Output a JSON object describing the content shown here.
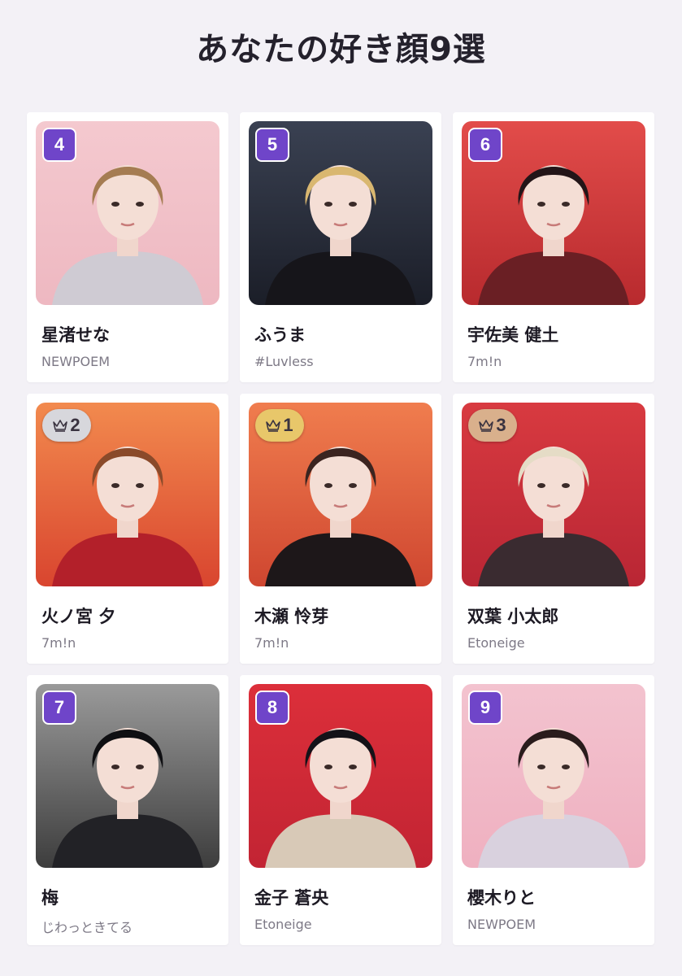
{
  "page": {
    "title": "あなたの好き顔9選"
  },
  "colors": {
    "badge_purple": "#6f45c9",
    "gold": "#e8c76a",
    "silver": "#d7d7dc",
    "bronze": "#d9b08c"
  },
  "cards": [
    {
      "rank": "4",
      "rank_style": "square",
      "name": "星渚せな",
      "group": "NEWPOEM",
      "bg_top": "#f4c9cf",
      "bg_bottom": "#eeb8c1",
      "hair": "#a57c52",
      "outfit": "#cfcbd3"
    },
    {
      "rank": "5",
      "rank_style": "square",
      "name": "ふうま",
      "group": "#Luvless",
      "bg_top": "#3a4152",
      "bg_bottom": "#1b1e28",
      "hair": "#d9b770",
      "outfit": "#16151a"
    },
    {
      "rank": "6",
      "rank_style": "square",
      "name": "宇佐美 健土",
      "group": "7m!n",
      "bg_top": "#e24c4a",
      "bg_bottom": "#b82a2e",
      "hair": "#231518",
      "outfit": "#6a1f24"
    },
    {
      "rank": "2",
      "rank_style": "silver",
      "name": "火ノ宮 夕",
      "group": "7m!n",
      "bg_top": "#f28a4e",
      "bg_bottom": "#d9452f",
      "hair": "#8a4a2a",
      "outfit": "#b3202a"
    },
    {
      "rank": "1",
      "rank_style": "gold",
      "name": "木瀬 怜芽",
      "group": "7m!n",
      "bg_top": "#f07d4e",
      "bg_bottom": "#cf4630",
      "hair": "#3b2420",
      "outfit": "#1d1719"
    },
    {
      "rank": "3",
      "rank_style": "bronze",
      "name": "双葉 小太郎",
      "group": "Etoneige",
      "bg_top": "#d83a40",
      "bg_bottom": "#b92634",
      "hair": "#e5dcc6",
      "outfit": "#3a2b30"
    },
    {
      "rank": "7",
      "rank_style": "square",
      "name": "梅",
      "group": "じわっときてる",
      "bg_top": "#9a9a9a",
      "bg_bottom": "#3d3d3d",
      "hair": "#0f0f12",
      "outfit": "#222226"
    },
    {
      "rank": "8",
      "rank_style": "square",
      "name": "金子 蒼央",
      "group": "Etoneige",
      "bg_top": "#dc2f3a",
      "bg_bottom": "#c22433",
      "hair": "#141218",
      "outfit": "#d8c9b7"
    },
    {
      "rank": "9",
      "rank_style": "square",
      "name": "櫻木りと",
      "group": "NEWPOEM",
      "bg_top": "#f3c3cf",
      "bg_bottom": "#efb0c0",
      "hair": "#2a1c1c",
      "outfit": "#d9d1de"
    }
  ]
}
